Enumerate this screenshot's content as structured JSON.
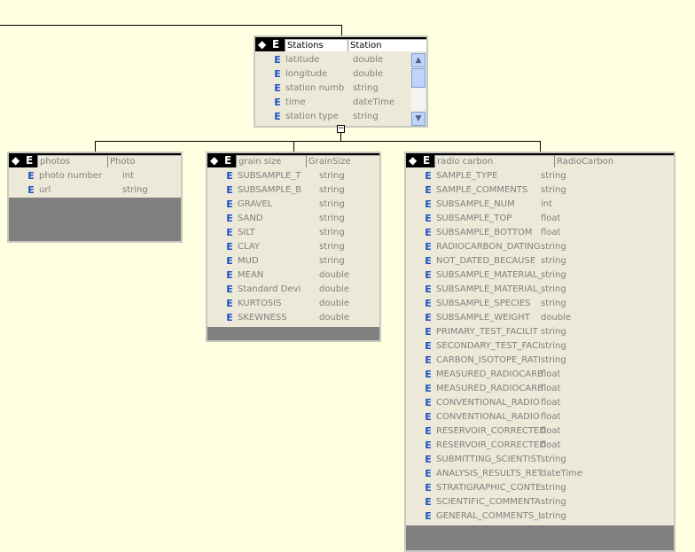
{
  "stations": {
    "name": "Stations",
    "type": "Station",
    "fields": [
      {
        "name": "latitude",
        "type": "double"
      },
      {
        "name": "longitude",
        "type": "double"
      },
      {
        "name": "station numb",
        "type": "string"
      },
      {
        "name": "time",
        "type": "dateTime"
      },
      {
        "name": "station type",
        "type": "string"
      }
    ]
  },
  "photos": {
    "name": "photos",
    "type": "Photo",
    "fields": [
      {
        "name": "photo number",
        "type": "int"
      },
      {
        "name": "url",
        "type": "string"
      }
    ]
  },
  "grain": {
    "name": "grain size",
    "type": "GrainSize",
    "fields": [
      {
        "name": "SUBSAMPLE_T",
        "type": "string"
      },
      {
        "name": "SUBSAMPLE_B",
        "type": "string"
      },
      {
        "name": "GRAVEL",
        "type": "string"
      },
      {
        "name": "SAND",
        "type": "string"
      },
      {
        "name": "SILT",
        "type": "string"
      },
      {
        "name": "CLAY",
        "type": "string"
      },
      {
        "name": "MUD",
        "type": "string"
      },
      {
        "name": "MEAN",
        "type": "double"
      },
      {
        "name": "Standard Devi",
        "type": "double"
      },
      {
        "name": "KURTOSIS",
        "type": "double"
      },
      {
        "name": "SKEWNESS",
        "type": "double"
      }
    ]
  },
  "radio": {
    "name": "radio carbon",
    "type": "RadioCarbon",
    "fields": [
      {
        "name": "SAMPLE_TYPE",
        "type": "string"
      },
      {
        "name": "SAMPLE_COMMENTS",
        "type": "string"
      },
      {
        "name": "SUBSAMPLE_NUM",
        "type": "int"
      },
      {
        "name": "SUBSAMPLE_TOP",
        "type": "float"
      },
      {
        "name": "SUBSAMPLE_BOTTOM",
        "type": "float"
      },
      {
        "name": "RADIOCARBON_DATING",
        "type": "string"
      },
      {
        "name": "NOT_DATED_BECAUSE",
        "type": "string"
      },
      {
        "name": "SUBSAMPLE_MATERIAL_",
        "type": "string"
      },
      {
        "name": "SUBSAMPLE_MATERIAL_",
        "type": "string"
      },
      {
        "name": "SUBSAMPLE_SPECIES",
        "type": "string"
      },
      {
        "name": "SUBSAMPLE_WEIGHT",
        "type": "double"
      },
      {
        "name": "PRIMARY_TEST_FACILIT",
        "type": "string"
      },
      {
        "name": "SECONDARY_TEST_FACI",
        "type": "string"
      },
      {
        "name": "CARBON_ISOTOPE_RATI",
        "type": "string"
      },
      {
        "name": "MEASURED_RADIOCARB",
        "type": "float"
      },
      {
        "name": "MEASURED_RADIOCARB",
        "type": "float"
      },
      {
        "name": "CONVENTIONAL_RADIO",
        "type": "float"
      },
      {
        "name": "CONVENTIONAL_RADIO",
        "type": "float"
      },
      {
        "name": "RESERVOIR_CORRECTED",
        "type": "float"
      },
      {
        "name": "RESERVOIR_CORRECTED",
        "type": "float"
      },
      {
        "name": "SUBMITTING_SCIENTIST",
        "type": "string"
      },
      {
        "name": "ANALYSIS_RESULTS_RET",
        "type": "dateTime"
      },
      {
        "name": "STRATIGRAPHIC_CONTE",
        "type": "string"
      },
      {
        "name": "SCIENTIFIC_COMMENTA",
        "type": "string"
      },
      {
        "name": "GENERAL_COMMENTS_L",
        "type": "string"
      }
    ]
  },
  "icons": {
    "element_letter": "E",
    "diamond": "◆",
    "scroll_up": "▲",
    "scroll_down": "▼",
    "collapse": "−"
  },
  "colors": {
    "background": "#ffffe1",
    "panel": "#ece9d8",
    "element_icon": "#1e50c8"
  }
}
